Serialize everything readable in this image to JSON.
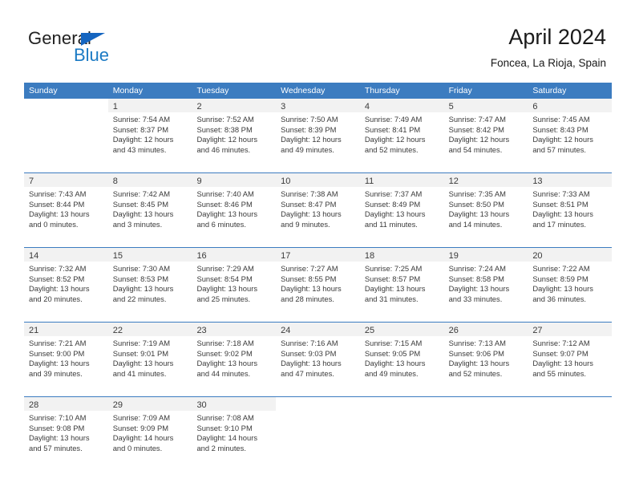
{
  "brand": {
    "name_part1": "General",
    "name_part2": "Blue",
    "flag_icon": "blue-triangle-flag-icon",
    "accent_color": "#1b7ac4"
  },
  "header": {
    "title": "April 2024",
    "subtitle": "Foncea, La Rioja, Spain"
  },
  "colors": {
    "header_band": "#3c7cc0",
    "date_band": "#f2f2f2",
    "text": "#3a3a3a"
  },
  "weekdays": [
    "Sunday",
    "Monday",
    "Tuesday",
    "Wednesday",
    "Thursday",
    "Friday",
    "Saturday"
  ],
  "weeks": [
    [
      {
        "day": "",
        "sunrise": "",
        "sunset": "",
        "daylight_line1": "",
        "daylight_line2": "",
        "empty": true
      },
      {
        "day": "1",
        "sunrise": "Sunrise: 7:54 AM",
        "sunset": "Sunset: 8:37 PM",
        "daylight_line1": "Daylight: 12 hours",
        "daylight_line2": "and 43 minutes.",
        "empty": false
      },
      {
        "day": "2",
        "sunrise": "Sunrise: 7:52 AM",
        "sunset": "Sunset: 8:38 PM",
        "daylight_line1": "Daylight: 12 hours",
        "daylight_line2": "and 46 minutes.",
        "empty": false
      },
      {
        "day": "3",
        "sunrise": "Sunrise: 7:50 AM",
        "sunset": "Sunset: 8:39 PM",
        "daylight_line1": "Daylight: 12 hours",
        "daylight_line2": "and 49 minutes.",
        "empty": false
      },
      {
        "day": "4",
        "sunrise": "Sunrise: 7:49 AM",
        "sunset": "Sunset: 8:41 PM",
        "daylight_line1": "Daylight: 12 hours",
        "daylight_line2": "and 52 minutes.",
        "empty": false
      },
      {
        "day": "5",
        "sunrise": "Sunrise: 7:47 AM",
        "sunset": "Sunset: 8:42 PM",
        "daylight_line1": "Daylight: 12 hours",
        "daylight_line2": "and 54 minutes.",
        "empty": false
      },
      {
        "day": "6",
        "sunrise": "Sunrise: 7:45 AM",
        "sunset": "Sunset: 8:43 PM",
        "daylight_line1": "Daylight: 12 hours",
        "daylight_line2": "and 57 minutes.",
        "empty": false
      }
    ],
    [
      {
        "day": "7",
        "sunrise": "Sunrise: 7:43 AM",
        "sunset": "Sunset: 8:44 PM",
        "daylight_line1": "Daylight: 13 hours",
        "daylight_line2": "and 0 minutes.",
        "empty": false
      },
      {
        "day": "8",
        "sunrise": "Sunrise: 7:42 AM",
        "sunset": "Sunset: 8:45 PM",
        "daylight_line1": "Daylight: 13 hours",
        "daylight_line2": "and 3 minutes.",
        "empty": false
      },
      {
        "day": "9",
        "sunrise": "Sunrise: 7:40 AM",
        "sunset": "Sunset: 8:46 PM",
        "daylight_line1": "Daylight: 13 hours",
        "daylight_line2": "and 6 minutes.",
        "empty": false
      },
      {
        "day": "10",
        "sunrise": "Sunrise: 7:38 AM",
        "sunset": "Sunset: 8:47 PM",
        "daylight_line1": "Daylight: 13 hours",
        "daylight_line2": "and 9 minutes.",
        "empty": false
      },
      {
        "day": "11",
        "sunrise": "Sunrise: 7:37 AM",
        "sunset": "Sunset: 8:49 PM",
        "daylight_line1": "Daylight: 13 hours",
        "daylight_line2": "and 11 minutes.",
        "empty": false
      },
      {
        "day": "12",
        "sunrise": "Sunrise: 7:35 AM",
        "sunset": "Sunset: 8:50 PM",
        "daylight_line1": "Daylight: 13 hours",
        "daylight_line2": "and 14 minutes.",
        "empty": false
      },
      {
        "day": "13",
        "sunrise": "Sunrise: 7:33 AM",
        "sunset": "Sunset: 8:51 PM",
        "daylight_line1": "Daylight: 13 hours",
        "daylight_line2": "and 17 minutes.",
        "empty": false
      }
    ],
    [
      {
        "day": "14",
        "sunrise": "Sunrise: 7:32 AM",
        "sunset": "Sunset: 8:52 PM",
        "daylight_line1": "Daylight: 13 hours",
        "daylight_line2": "and 20 minutes.",
        "empty": false
      },
      {
        "day": "15",
        "sunrise": "Sunrise: 7:30 AM",
        "sunset": "Sunset: 8:53 PM",
        "daylight_line1": "Daylight: 13 hours",
        "daylight_line2": "and 22 minutes.",
        "empty": false
      },
      {
        "day": "16",
        "sunrise": "Sunrise: 7:29 AM",
        "sunset": "Sunset: 8:54 PM",
        "daylight_line1": "Daylight: 13 hours",
        "daylight_line2": "and 25 minutes.",
        "empty": false
      },
      {
        "day": "17",
        "sunrise": "Sunrise: 7:27 AM",
        "sunset": "Sunset: 8:55 PM",
        "daylight_line1": "Daylight: 13 hours",
        "daylight_line2": "and 28 minutes.",
        "empty": false
      },
      {
        "day": "18",
        "sunrise": "Sunrise: 7:25 AM",
        "sunset": "Sunset: 8:57 PM",
        "daylight_line1": "Daylight: 13 hours",
        "daylight_line2": "and 31 minutes.",
        "empty": false
      },
      {
        "day": "19",
        "sunrise": "Sunrise: 7:24 AM",
        "sunset": "Sunset: 8:58 PM",
        "daylight_line1": "Daylight: 13 hours",
        "daylight_line2": "and 33 minutes.",
        "empty": false
      },
      {
        "day": "20",
        "sunrise": "Sunrise: 7:22 AM",
        "sunset": "Sunset: 8:59 PM",
        "daylight_line1": "Daylight: 13 hours",
        "daylight_line2": "and 36 minutes.",
        "empty": false
      }
    ],
    [
      {
        "day": "21",
        "sunrise": "Sunrise: 7:21 AM",
        "sunset": "Sunset: 9:00 PM",
        "daylight_line1": "Daylight: 13 hours",
        "daylight_line2": "and 39 minutes.",
        "empty": false
      },
      {
        "day": "22",
        "sunrise": "Sunrise: 7:19 AM",
        "sunset": "Sunset: 9:01 PM",
        "daylight_line1": "Daylight: 13 hours",
        "daylight_line2": "and 41 minutes.",
        "empty": false
      },
      {
        "day": "23",
        "sunrise": "Sunrise: 7:18 AM",
        "sunset": "Sunset: 9:02 PM",
        "daylight_line1": "Daylight: 13 hours",
        "daylight_line2": "and 44 minutes.",
        "empty": false
      },
      {
        "day": "24",
        "sunrise": "Sunrise: 7:16 AM",
        "sunset": "Sunset: 9:03 PM",
        "daylight_line1": "Daylight: 13 hours",
        "daylight_line2": "and 47 minutes.",
        "empty": false
      },
      {
        "day": "25",
        "sunrise": "Sunrise: 7:15 AM",
        "sunset": "Sunset: 9:05 PM",
        "daylight_line1": "Daylight: 13 hours",
        "daylight_line2": "and 49 minutes.",
        "empty": false
      },
      {
        "day": "26",
        "sunrise": "Sunrise: 7:13 AM",
        "sunset": "Sunset: 9:06 PM",
        "daylight_line1": "Daylight: 13 hours",
        "daylight_line2": "and 52 minutes.",
        "empty": false
      },
      {
        "day": "27",
        "sunrise": "Sunrise: 7:12 AM",
        "sunset": "Sunset: 9:07 PM",
        "daylight_line1": "Daylight: 13 hours",
        "daylight_line2": "and 55 minutes.",
        "empty": false
      }
    ],
    [
      {
        "day": "28",
        "sunrise": "Sunrise: 7:10 AM",
        "sunset": "Sunset: 9:08 PM",
        "daylight_line1": "Daylight: 13 hours",
        "daylight_line2": "and 57 minutes.",
        "empty": false
      },
      {
        "day": "29",
        "sunrise": "Sunrise: 7:09 AM",
        "sunset": "Sunset: 9:09 PM",
        "daylight_line1": "Daylight: 14 hours",
        "daylight_line2": "and 0 minutes.",
        "empty": false
      },
      {
        "day": "30",
        "sunrise": "Sunrise: 7:08 AM",
        "sunset": "Sunset: 9:10 PM",
        "daylight_line1": "Daylight: 14 hours",
        "daylight_line2": "and 2 minutes.",
        "empty": false
      },
      {
        "day": "",
        "sunrise": "",
        "sunset": "",
        "daylight_line1": "",
        "daylight_line2": "",
        "empty": true
      },
      {
        "day": "",
        "sunrise": "",
        "sunset": "",
        "daylight_line1": "",
        "daylight_line2": "",
        "empty": true
      },
      {
        "day": "",
        "sunrise": "",
        "sunset": "",
        "daylight_line1": "",
        "daylight_line2": "",
        "empty": true
      },
      {
        "day": "",
        "sunrise": "",
        "sunset": "",
        "daylight_line1": "",
        "daylight_line2": "",
        "empty": true
      }
    ]
  ]
}
